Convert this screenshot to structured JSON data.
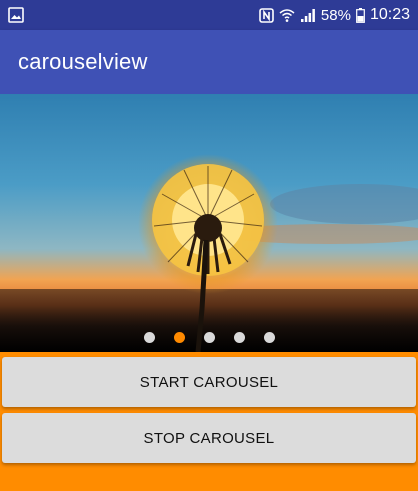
{
  "status_bar": {
    "battery": "58%",
    "time": "10:23",
    "icons": [
      "image-notification-icon",
      "nfc-icon",
      "wifi-icon",
      "signal-icon",
      "battery-icon"
    ]
  },
  "app_bar": {
    "title": "carouselview"
  },
  "carousel": {
    "image": "dandelion-sunset",
    "page_count": 5,
    "active_index": 1,
    "indicator_color": "#ff8a00"
  },
  "buttons": {
    "start_label": "START CAROUSEL",
    "stop_label": "STOP CAROUSEL"
  },
  "colors": {
    "primary": "#3f51b5",
    "primary_dark": "#2e3b96",
    "accent": "#ff8c00"
  }
}
